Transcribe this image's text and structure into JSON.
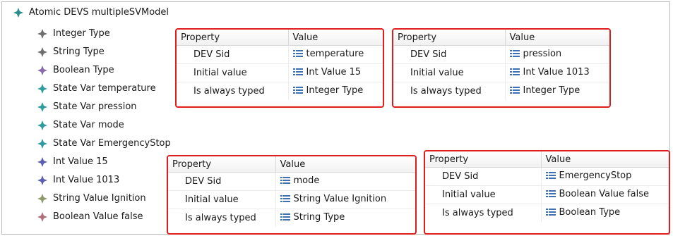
{
  "tree": {
    "root": {
      "label": "Atomic DEVS multipleSVModel",
      "icon": "diamond-green-icon",
      "color": "#2b8c8c"
    },
    "children": [
      {
        "label": "Integer Type",
        "icon": "diamond-gray-icon",
        "color": "#6e6e6e"
      },
      {
        "label": "String Type",
        "icon": "diamond-gray-icon",
        "color": "#6e6e6e"
      },
      {
        "label": "Boolean Type",
        "icon": "diamond-purple-icon",
        "color": "#8a6aa8"
      },
      {
        "label": "State Var temperature",
        "icon": "diamond-teal-icon",
        "color": "#2f9aa0"
      },
      {
        "label": "State Var pression",
        "icon": "diamond-teal-icon",
        "color": "#2f9aa0"
      },
      {
        "label": "State Var mode",
        "icon": "diamond-teal-icon",
        "color": "#2f9aa0"
      },
      {
        "label": "State Var EmergencyStop",
        "icon": "diamond-teal-icon",
        "color": "#2f9aa0"
      },
      {
        "label": "Int Value 15",
        "icon": "diamond-blue-icon",
        "color": "#5a5fb4"
      },
      {
        "label": "Int Value 1013",
        "icon": "diamond-blue-icon",
        "color": "#5a5fb4"
      },
      {
        "label": "String Value Ignition",
        "icon": "diamond-olive-icon",
        "color": "#8f9a6a"
      },
      {
        "label": "Boolean Value false",
        "icon": "diamond-rose-icon",
        "color": "#b0707a"
      }
    ]
  },
  "property_tables": [
    {
      "header": {
        "property": "Property",
        "value": "Value"
      },
      "rows": [
        {
          "property": "DEV Sid",
          "value": "temperature"
        },
        {
          "property": "Initial value",
          "value": "Int Value 15"
        },
        {
          "property": "Is always typed",
          "value": "Integer Type"
        }
      ]
    },
    {
      "header": {
        "property": "Property",
        "value": "Value"
      },
      "rows": [
        {
          "property": "DEV Sid",
          "value": "pression"
        },
        {
          "property": "Initial value",
          "value": "Int Value 1013"
        },
        {
          "property": "Is always typed",
          "value": "Integer Type"
        }
      ]
    },
    {
      "header": {
        "property": "Property",
        "value": "Value"
      },
      "rows": [
        {
          "property": "DEV Sid",
          "value": "mode"
        },
        {
          "property": "Initial value",
          "value": "String Value Ignition"
        },
        {
          "property": "Is always typed",
          "value": "String Type"
        }
      ]
    },
    {
      "header": {
        "property": "Property",
        "value": "Value"
      },
      "rows": [
        {
          "property": "DEV Sid",
          "value": "EmergencyStop"
        },
        {
          "property": "Initial value",
          "value": "Boolean Value false"
        },
        {
          "property": "Is always typed",
          "value": "Boolean Type"
        }
      ]
    }
  ],
  "colors": {
    "highlight_border": "#e01c1c",
    "value_icon": "#3d6fb5"
  }
}
